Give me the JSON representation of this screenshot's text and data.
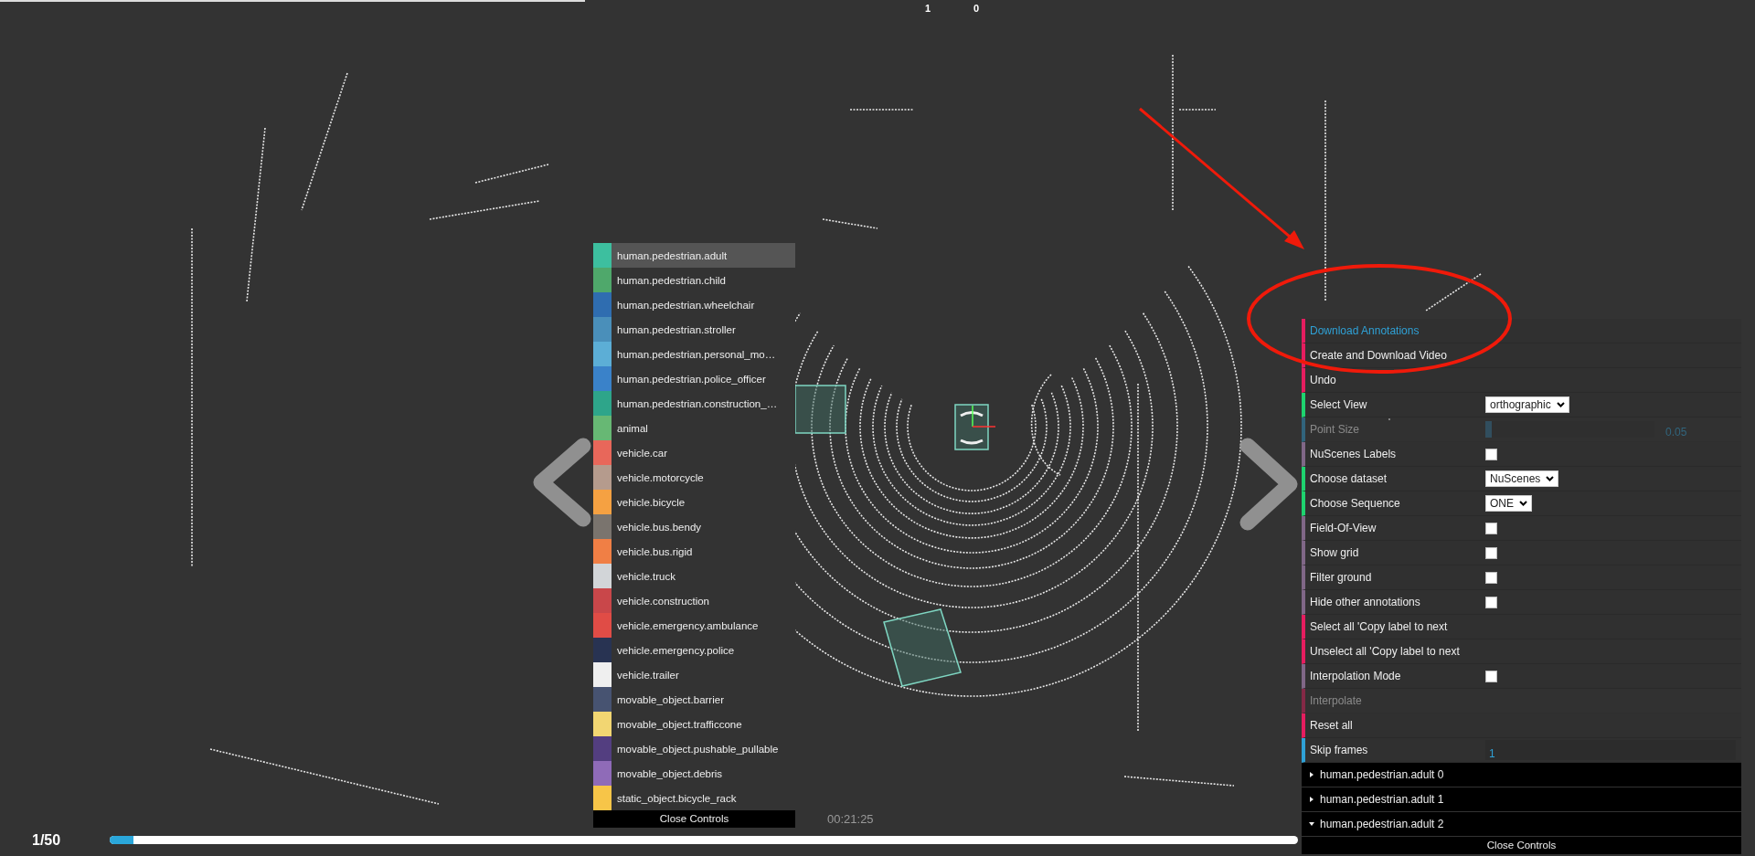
{
  "top_bar": {
    "counters": [
      "1",
      "0"
    ]
  },
  "label_panel": {
    "labels": [
      {
        "name": "human.pedestrian.adult",
        "color": "#3dbf9f",
        "selected": true
      },
      {
        "name": "human.pedestrian.child",
        "color": "#4fa86b",
        "selected": false
      },
      {
        "name": "human.pedestrian.wheelchair",
        "color": "#2f6db0",
        "selected": false
      },
      {
        "name": "human.pedestrian.stroller",
        "color": "#4a8fba",
        "selected": false
      },
      {
        "name": "human.pedestrian.personal_mo…",
        "color": "#5caed6",
        "selected": false
      },
      {
        "name": "human.pedestrian.police_officer",
        "color": "#3a82c9",
        "selected": false
      },
      {
        "name": "human.pedestrian.construction_…",
        "color": "#2ea58a",
        "selected": false
      },
      {
        "name": "animal",
        "color": "#67b874",
        "selected": false
      },
      {
        "name": "vehicle.car",
        "color": "#e8675a",
        "selected": false
      },
      {
        "name": "vehicle.motorcycle",
        "color": "#b59b8d",
        "selected": false
      },
      {
        "name": "vehicle.bicycle",
        "color": "#f5a142",
        "selected": false
      },
      {
        "name": "vehicle.bus.bendy",
        "color": "#7a746e",
        "selected": false
      },
      {
        "name": "vehicle.bus.rigid",
        "color": "#f07f45",
        "selected": false
      },
      {
        "name": "vehicle.truck",
        "color": "#d2d5d8",
        "selected": false
      },
      {
        "name": "vehicle.construction",
        "color": "#c9474a",
        "selected": false
      },
      {
        "name": "vehicle.emergency.ambulance",
        "color": "#e04c46",
        "selected": false
      },
      {
        "name": "vehicle.emergency.police",
        "color": "#283352",
        "selected": false
      },
      {
        "name": "vehicle.trailer",
        "color": "#efefef",
        "selected": false
      },
      {
        "name": "movable_object.barrier",
        "color": "#475371",
        "selected": false
      },
      {
        "name": "movable_object.trafficcone",
        "color": "#f2d672",
        "selected": false
      },
      {
        "name": "movable_object.pushable_pullable",
        "color": "#533e80",
        "selected": false
      },
      {
        "name": "movable_object.debris",
        "color": "#8f6bb8",
        "selected": false
      },
      {
        "name": "static_object.bicycle_rack",
        "color": "#f7c548",
        "selected": false
      }
    ],
    "close_button": "Close Controls"
  },
  "controls_panel": {
    "rows": [
      {
        "kind": "button",
        "label": "Download Annotations",
        "highlighted": true,
        "disabled": false
      },
      {
        "kind": "button",
        "label": "Create and Download Video",
        "highlighted": false,
        "disabled": false
      },
      {
        "kind": "button",
        "label": "Undo",
        "highlighted": false,
        "disabled": false
      },
      {
        "kind": "select",
        "label": "Select View",
        "value": "orthographic",
        "disabled": false
      },
      {
        "kind": "slider",
        "label": "Point Size",
        "level": 0.04,
        "value": "0.05",
        "disabled": true
      },
      {
        "kind": "checkbox",
        "label": "NuScenes Labels",
        "checked": false,
        "disabled": false
      },
      {
        "kind": "select",
        "label": "Choose dataset",
        "value": "NuScenes",
        "disabled": false
      },
      {
        "kind": "select",
        "label": "Choose Sequence",
        "value": "ONE",
        "disabled": false
      },
      {
        "kind": "checkbox",
        "label": "Field-Of-View",
        "checked": false,
        "disabled": false
      },
      {
        "kind": "checkbox",
        "label": "Show grid",
        "checked": false,
        "disabled": false
      },
      {
        "kind": "checkbox",
        "label": "Filter ground",
        "checked": false,
        "disabled": false
      },
      {
        "kind": "checkbox",
        "label": "Hide other annotations",
        "checked": false,
        "disabled": false
      },
      {
        "kind": "button",
        "label": "Select all 'Copy label to next",
        "highlighted": false,
        "disabled": false
      },
      {
        "kind": "button",
        "label": "Unselect all 'Copy label to next",
        "highlighted": false,
        "disabled": false
      },
      {
        "kind": "checkbox",
        "label": "Interpolation Mode",
        "checked": false,
        "disabled": false
      },
      {
        "kind": "button",
        "label": "Interpolate",
        "highlighted": false,
        "disabled": true
      },
      {
        "kind": "button",
        "label": "Reset all",
        "highlighted": false,
        "disabled": false
      },
      {
        "kind": "input",
        "label": "Skip frames",
        "value": "1",
        "disabled": false
      }
    ],
    "folders": [
      {
        "label": "human.pedestrian.adult 0",
        "expanded": false
      },
      {
        "label": "human.pedestrian.adult 1",
        "expanded": false
      },
      {
        "label": "human.pedestrian.adult 2",
        "expanded": true
      }
    ],
    "close_button": "Close Controls"
  },
  "timeline": {
    "frame": "1/50",
    "level": 0.02,
    "time": "00:21:25"
  }
}
